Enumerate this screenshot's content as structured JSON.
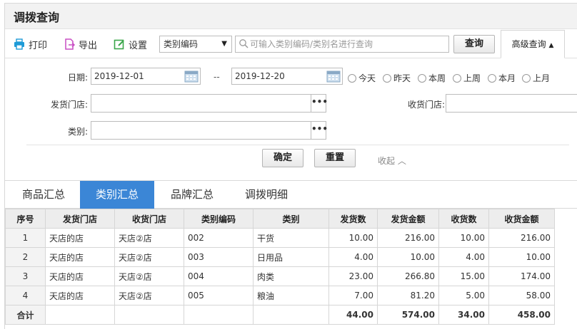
{
  "page": {
    "title": "调拨查询"
  },
  "toolbar": {
    "print_label": "打印",
    "export_label": "导出",
    "settings_label": "设置",
    "search_field": "类别编码",
    "search_placeholder": "可输入类别编码/类别名进行查询",
    "query_label": "查询",
    "advanced_label": "高级查询",
    "advanced_arrow": "▲",
    "select_arrow": "▼"
  },
  "filter": {
    "date_label": "日期:",
    "date_from": "2019-12-01",
    "date_sep": "--",
    "date_to": "2019-12-20",
    "quick": [
      "今天",
      "昨天",
      "本周",
      "上周",
      "本月",
      "上月"
    ],
    "ship_store_label": "发货门店:",
    "recv_store_label": "收货门店:",
    "category_label": "类别:",
    "ellipsis": "•••",
    "confirm_label": "确定",
    "reset_label": "重置",
    "collapse_label": "收起",
    "collapse_arrow": "︿"
  },
  "tabs": [
    {
      "label": "商品汇总",
      "active": false
    },
    {
      "label": "类别汇总",
      "active": true
    },
    {
      "label": "品牌汇总",
      "active": false
    },
    {
      "label": "调拨明细",
      "active": false
    }
  ],
  "table": {
    "headers": [
      "序号",
      "发货门店",
      "收货门店",
      "类别编码",
      "类别",
      "发货数",
      "发货金额",
      "收货数",
      "收货金额"
    ],
    "rows": [
      [
        "1",
        "天店的店",
        "天店②店",
        "002",
        "干货",
        "10.00",
        "216.00",
        "10.00",
        "216.00"
      ],
      [
        "2",
        "天店的店",
        "天店②店",
        "003",
        "日用品",
        "4.00",
        "10.00",
        "4.00",
        "10.00"
      ],
      [
        "3",
        "天店的店",
        "天店②店",
        "004",
        "肉类",
        "23.00",
        "266.80",
        "15.00",
        "174.00"
      ],
      [
        "4",
        "天店的店",
        "天店②店",
        "005",
        "粮油",
        "7.00",
        "81.20",
        "5.00",
        "58.00"
      ]
    ],
    "total": [
      "合计",
      "",
      "",
      "",
      "",
      "44.00",
      "574.00",
      "34.00",
      "458.00"
    ]
  },
  "colors": {
    "accent": "#3b86d6",
    "print_icon": "#1e9bd7",
    "export_icon": "#c94fc4",
    "settings_icon": "#3aa64a"
  }
}
